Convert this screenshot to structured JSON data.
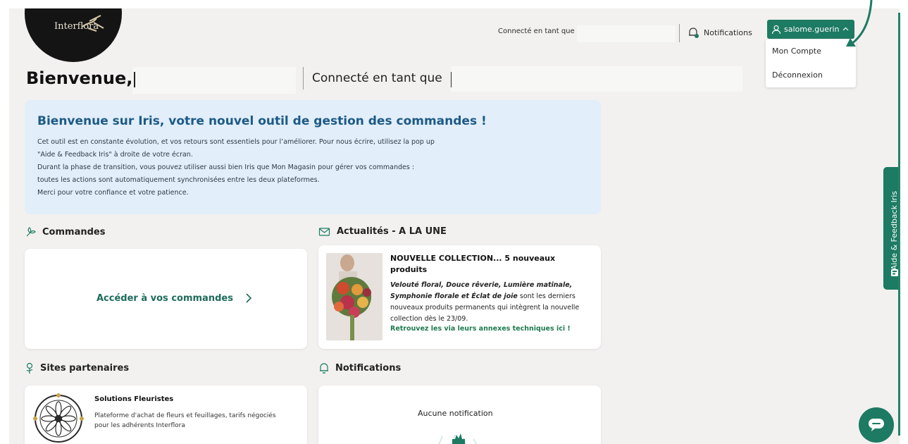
{
  "header": {
    "logo_text": "Interflora",
    "connected_label": "Connecté en tant que",
    "notifications_label": "Notifications",
    "username": "salome.guerin",
    "user_menu": [
      "Mon Compte",
      "Déconnexion"
    ]
  },
  "welcome": {
    "greeting": "Bienvenue,",
    "connected_label": "Connecté en tant que"
  },
  "banner": {
    "title": "Bienvenue sur Iris, votre nouvel outil de gestion des commandes !",
    "lines": [
      "Cet outil est en constante évolution, et vos retours sont essentiels pour l’améliorer. Pour nous écrire, utilisez la pop up",
      "\"Aide & Feedback Iris\" à droite de votre écran.",
      "Durant la phase de transition, vous pouvez utiliser aussi bien Iris que Mon Magasin pour gérer vos commandes :",
      "toutes les actions sont automatiquement synchronisées entre les deux plateformes.",
      "Merci pour votre confiance et votre patience."
    ]
  },
  "orders": {
    "heading": "Commandes",
    "link_label": "Accéder à vos commandes"
  },
  "news": {
    "heading": "Actualités - A LA UNE",
    "title": "NOUVELLE COLLECTION... 5 nouveaux produits",
    "products": "Velouté floral, Douce rêverie, Lumière matinale, Symphonie florale et Éclat de joie",
    "body": "sont les derniers nouveaux produits permanents qui intègrent la nouvelle collection dès le 23/09.",
    "link": "Retrouvez les via leurs annexes techniques ici !"
  },
  "partners": {
    "heading": "Sites partenaires",
    "title": "Solutions Fleuristes",
    "description": "Plateforme d'achat de fleurs et feuillages, tarifs négociés pour les adhérents Interflora"
  },
  "notifications": {
    "heading": "Notifications",
    "empty": "Aucune notification"
  },
  "feedback_tab": "Aide & Feedback Iris",
  "colors": {
    "brand_green": "#1d7a63",
    "banner_bg": "#e2eefa",
    "banner_title": "#1c5a86",
    "page_bg": "#f2f1ef"
  },
  "icons": [
    "bell-icon",
    "user-icon",
    "chevron-up-icon",
    "bouquet-icon",
    "envelope-icon",
    "flower-icon",
    "chevron-right-icon",
    "chat-icon",
    "feedback-icon"
  ]
}
